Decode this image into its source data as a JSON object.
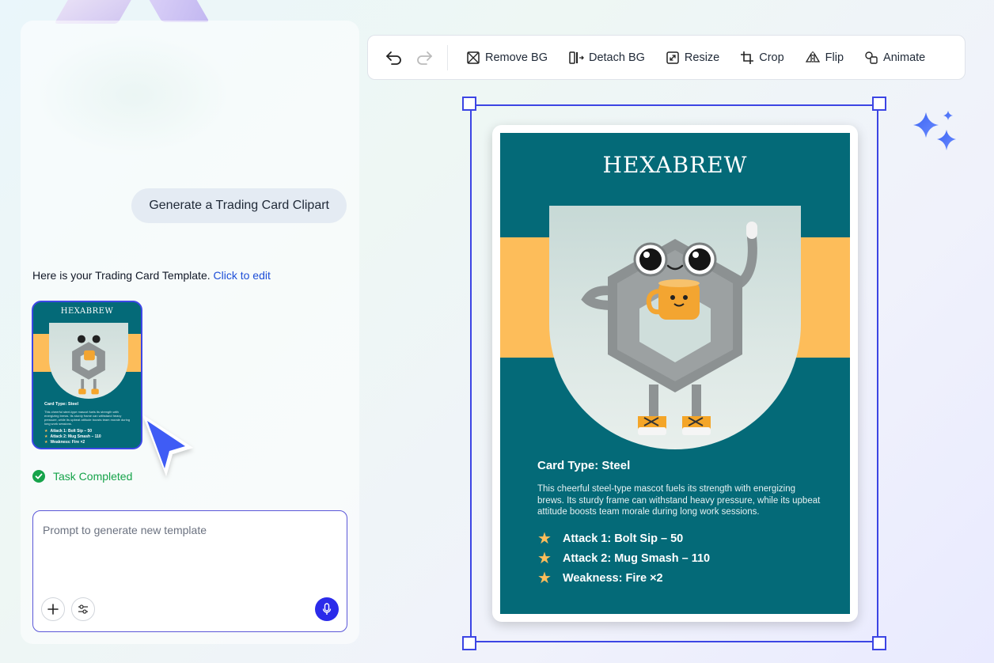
{
  "chat": {
    "user_message": "Generate a Trading Card Clipart",
    "reply_text": "Here is your Trading Card Template.",
    "reply_link": "Click to edit",
    "task_status": "Task Completed",
    "prompt_placeholder": "Prompt to generate new template"
  },
  "toolbar": {
    "undo_icon": "undo-icon",
    "redo_icon": "redo-icon",
    "buttons": [
      {
        "label": "Remove BG",
        "icon": "remove-bg-icon"
      },
      {
        "label": "Detach BG",
        "icon": "detach-bg-icon"
      },
      {
        "label": "Resize",
        "icon": "resize-icon"
      },
      {
        "label": "Crop",
        "icon": "crop-icon"
      },
      {
        "label": "Flip",
        "icon": "flip-icon"
      },
      {
        "label": "Animate",
        "icon": "animate-icon"
      }
    ]
  },
  "card": {
    "title": "HEXABREW",
    "type_line": "Card Type: Steel",
    "description": "This cheerful steel-type mascot fuels its strength with energizing brews. Its sturdy frame can withstand heavy pressure, while its upbeat attitude boosts team morale during long work sessions.",
    "stats": [
      "Attack 1: Bolt Sip – 50",
      "Attack 2: Mug Smash – 110",
      "Weakness: Fire ×2"
    ],
    "colors": {
      "background": "#046a78",
      "band": "#fdbd5a",
      "accent": "#3c45e4"
    }
  }
}
